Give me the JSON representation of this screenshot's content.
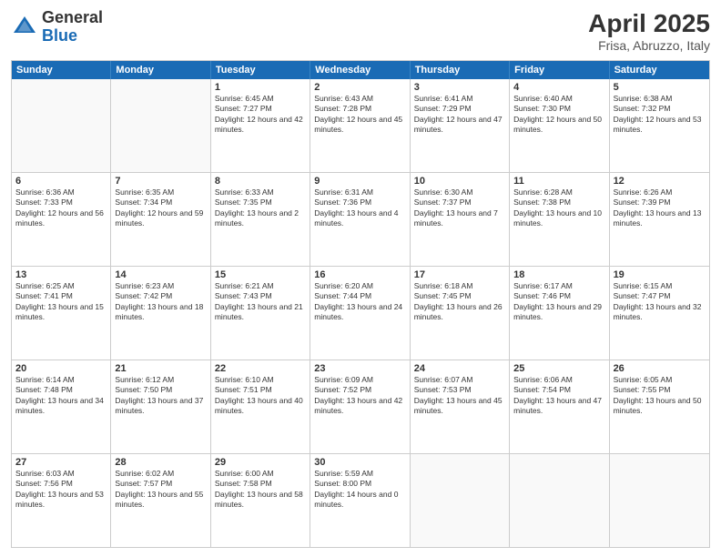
{
  "logo": {
    "general": "General",
    "blue": "Blue"
  },
  "title": "April 2025",
  "location": "Frisa, Abruzzo, Italy",
  "header_days": [
    "Sunday",
    "Monday",
    "Tuesday",
    "Wednesday",
    "Thursday",
    "Friday",
    "Saturday"
  ],
  "rows": [
    [
      {
        "date": "",
        "empty": true
      },
      {
        "date": "",
        "empty": true
      },
      {
        "date": "1",
        "sunrise": "Sunrise: 6:45 AM",
        "sunset": "Sunset: 7:27 PM",
        "daylight": "Daylight: 12 hours and 42 minutes."
      },
      {
        "date": "2",
        "sunrise": "Sunrise: 6:43 AM",
        "sunset": "Sunset: 7:28 PM",
        "daylight": "Daylight: 12 hours and 45 minutes."
      },
      {
        "date": "3",
        "sunrise": "Sunrise: 6:41 AM",
        "sunset": "Sunset: 7:29 PM",
        "daylight": "Daylight: 12 hours and 47 minutes."
      },
      {
        "date": "4",
        "sunrise": "Sunrise: 6:40 AM",
        "sunset": "Sunset: 7:30 PM",
        "daylight": "Daylight: 12 hours and 50 minutes."
      },
      {
        "date": "5",
        "sunrise": "Sunrise: 6:38 AM",
        "sunset": "Sunset: 7:32 PM",
        "daylight": "Daylight: 12 hours and 53 minutes."
      }
    ],
    [
      {
        "date": "6",
        "sunrise": "Sunrise: 6:36 AM",
        "sunset": "Sunset: 7:33 PM",
        "daylight": "Daylight: 12 hours and 56 minutes."
      },
      {
        "date": "7",
        "sunrise": "Sunrise: 6:35 AM",
        "sunset": "Sunset: 7:34 PM",
        "daylight": "Daylight: 12 hours and 59 minutes."
      },
      {
        "date": "8",
        "sunrise": "Sunrise: 6:33 AM",
        "sunset": "Sunset: 7:35 PM",
        "daylight": "Daylight: 13 hours and 2 minutes."
      },
      {
        "date": "9",
        "sunrise": "Sunrise: 6:31 AM",
        "sunset": "Sunset: 7:36 PM",
        "daylight": "Daylight: 13 hours and 4 minutes."
      },
      {
        "date": "10",
        "sunrise": "Sunrise: 6:30 AM",
        "sunset": "Sunset: 7:37 PM",
        "daylight": "Daylight: 13 hours and 7 minutes."
      },
      {
        "date": "11",
        "sunrise": "Sunrise: 6:28 AM",
        "sunset": "Sunset: 7:38 PM",
        "daylight": "Daylight: 13 hours and 10 minutes."
      },
      {
        "date": "12",
        "sunrise": "Sunrise: 6:26 AM",
        "sunset": "Sunset: 7:39 PM",
        "daylight": "Daylight: 13 hours and 13 minutes."
      }
    ],
    [
      {
        "date": "13",
        "sunrise": "Sunrise: 6:25 AM",
        "sunset": "Sunset: 7:41 PM",
        "daylight": "Daylight: 13 hours and 15 minutes."
      },
      {
        "date": "14",
        "sunrise": "Sunrise: 6:23 AM",
        "sunset": "Sunset: 7:42 PM",
        "daylight": "Daylight: 13 hours and 18 minutes."
      },
      {
        "date": "15",
        "sunrise": "Sunrise: 6:21 AM",
        "sunset": "Sunset: 7:43 PM",
        "daylight": "Daylight: 13 hours and 21 minutes."
      },
      {
        "date": "16",
        "sunrise": "Sunrise: 6:20 AM",
        "sunset": "Sunset: 7:44 PM",
        "daylight": "Daylight: 13 hours and 24 minutes."
      },
      {
        "date": "17",
        "sunrise": "Sunrise: 6:18 AM",
        "sunset": "Sunset: 7:45 PM",
        "daylight": "Daylight: 13 hours and 26 minutes."
      },
      {
        "date": "18",
        "sunrise": "Sunrise: 6:17 AM",
        "sunset": "Sunset: 7:46 PM",
        "daylight": "Daylight: 13 hours and 29 minutes."
      },
      {
        "date": "19",
        "sunrise": "Sunrise: 6:15 AM",
        "sunset": "Sunset: 7:47 PM",
        "daylight": "Daylight: 13 hours and 32 minutes."
      }
    ],
    [
      {
        "date": "20",
        "sunrise": "Sunrise: 6:14 AM",
        "sunset": "Sunset: 7:48 PM",
        "daylight": "Daylight: 13 hours and 34 minutes."
      },
      {
        "date": "21",
        "sunrise": "Sunrise: 6:12 AM",
        "sunset": "Sunset: 7:50 PM",
        "daylight": "Daylight: 13 hours and 37 minutes."
      },
      {
        "date": "22",
        "sunrise": "Sunrise: 6:10 AM",
        "sunset": "Sunset: 7:51 PM",
        "daylight": "Daylight: 13 hours and 40 minutes."
      },
      {
        "date": "23",
        "sunrise": "Sunrise: 6:09 AM",
        "sunset": "Sunset: 7:52 PM",
        "daylight": "Daylight: 13 hours and 42 minutes."
      },
      {
        "date": "24",
        "sunrise": "Sunrise: 6:07 AM",
        "sunset": "Sunset: 7:53 PM",
        "daylight": "Daylight: 13 hours and 45 minutes."
      },
      {
        "date": "25",
        "sunrise": "Sunrise: 6:06 AM",
        "sunset": "Sunset: 7:54 PM",
        "daylight": "Daylight: 13 hours and 47 minutes."
      },
      {
        "date": "26",
        "sunrise": "Sunrise: 6:05 AM",
        "sunset": "Sunset: 7:55 PM",
        "daylight": "Daylight: 13 hours and 50 minutes."
      }
    ],
    [
      {
        "date": "27",
        "sunrise": "Sunrise: 6:03 AM",
        "sunset": "Sunset: 7:56 PM",
        "daylight": "Daylight: 13 hours and 53 minutes."
      },
      {
        "date": "28",
        "sunrise": "Sunrise: 6:02 AM",
        "sunset": "Sunset: 7:57 PM",
        "daylight": "Daylight: 13 hours and 55 minutes."
      },
      {
        "date": "29",
        "sunrise": "Sunrise: 6:00 AM",
        "sunset": "Sunset: 7:58 PM",
        "daylight": "Daylight: 13 hours and 58 minutes."
      },
      {
        "date": "30",
        "sunrise": "Sunrise: 5:59 AM",
        "sunset": "Sunset: 8:00 PM",
        "daylight": "Daylight: 14 hours and 0 minutes."
      },
      {
        "date": "",
        "empty": true
      },
      {
        "date": "",
        "empty": true
      },
      {
        "date": "",
        "empty": true
      }
    ]
  ]
}
